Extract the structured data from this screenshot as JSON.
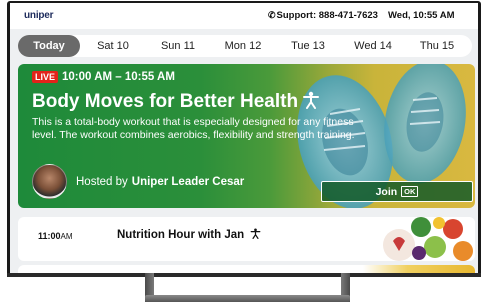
{
  "header": {
    "logo_text": "uniper",
    "support_label": "Support: 888-471-7623",
    "datetime": "Wed, 10:55 AM"
  },
  "day_tabs": [
    {
      "label": "Today",
      "active": true
    },
    {
      "label": "Sat 10",
      "active": false
    },
    {
      "label": "Sun 11",
      "active": false
    },
    {
      "label": "Mon 12",
      "active": false
    },
    {
      "label": "Tue 13",
      "active": false
    },
    {
      "label": "Wed 14",
      "active": false
    },
    {
      "label": "Thu 15",
      "active": false
    }
  ],
  "live_session": {
    "badge": "LIVE",
    "time": "10:00 AM – 10:55 AM",
    "title": "Body Moves for Better Health",
    "description": "This is a total-body workout that is especially designed for any fitness level. The workout combines aerobics, flexibility and strength training.",
    "host_prefix": "Hosted by",
    "host_name": "Uniper Leader Cesar",
    "join_label": "Join",
    "join_key": "OK"
  },
  "programs": [
    {
      "time": "11:00",
      "ampm": "AM",
      "title": "Nutrition Hour with Jan"
    }
  ],
  "colors": {
    "live_badge": "#e2231a",
    "card_green": "#1e8a3a",
    "card_yellow": "#d9b840",
    "active_tab": "#6a6a6a"
  }
}
